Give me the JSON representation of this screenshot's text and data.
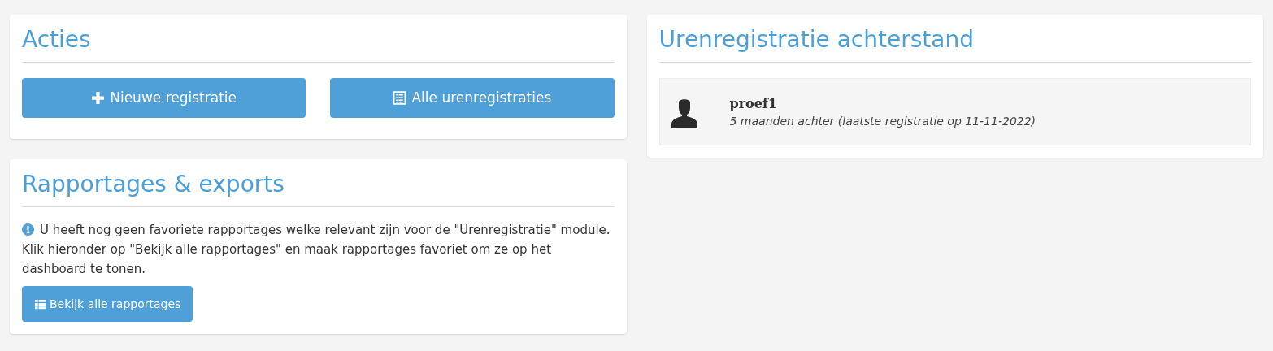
{
  "acties": {
    "title": "Acties",
    "buttons": [
      {
        "label": "Nieuwe registratie",
        "kind": "plus"
      },
      {
        "label": "Alle urenregistraties",
        "kind": "list-alt"
      }
    ]
  },
  "rapportages": {
    "title": "Rapportages & exports",
    "info": "U heeft nog geen favoriete rapportages welke relevant zijn voor de \"Urenregistratie\" module. Klik hieronder op \"Bekijk alle rapportages\" en maak rapportages favoriet om ze op het dashboard te tonen.",
    "button": {
      "label": "Bekijk alle rapportages",
      "kind": "list"
    }
  },
  "achterstand": {
    "title": "Urenregistratie achterstand",
    "users": [
      {
        "name": "proef1",
        "detail": "5 maanden achter (laatste registratie op 11-11-2022)"
      }
    ]
  }
}
